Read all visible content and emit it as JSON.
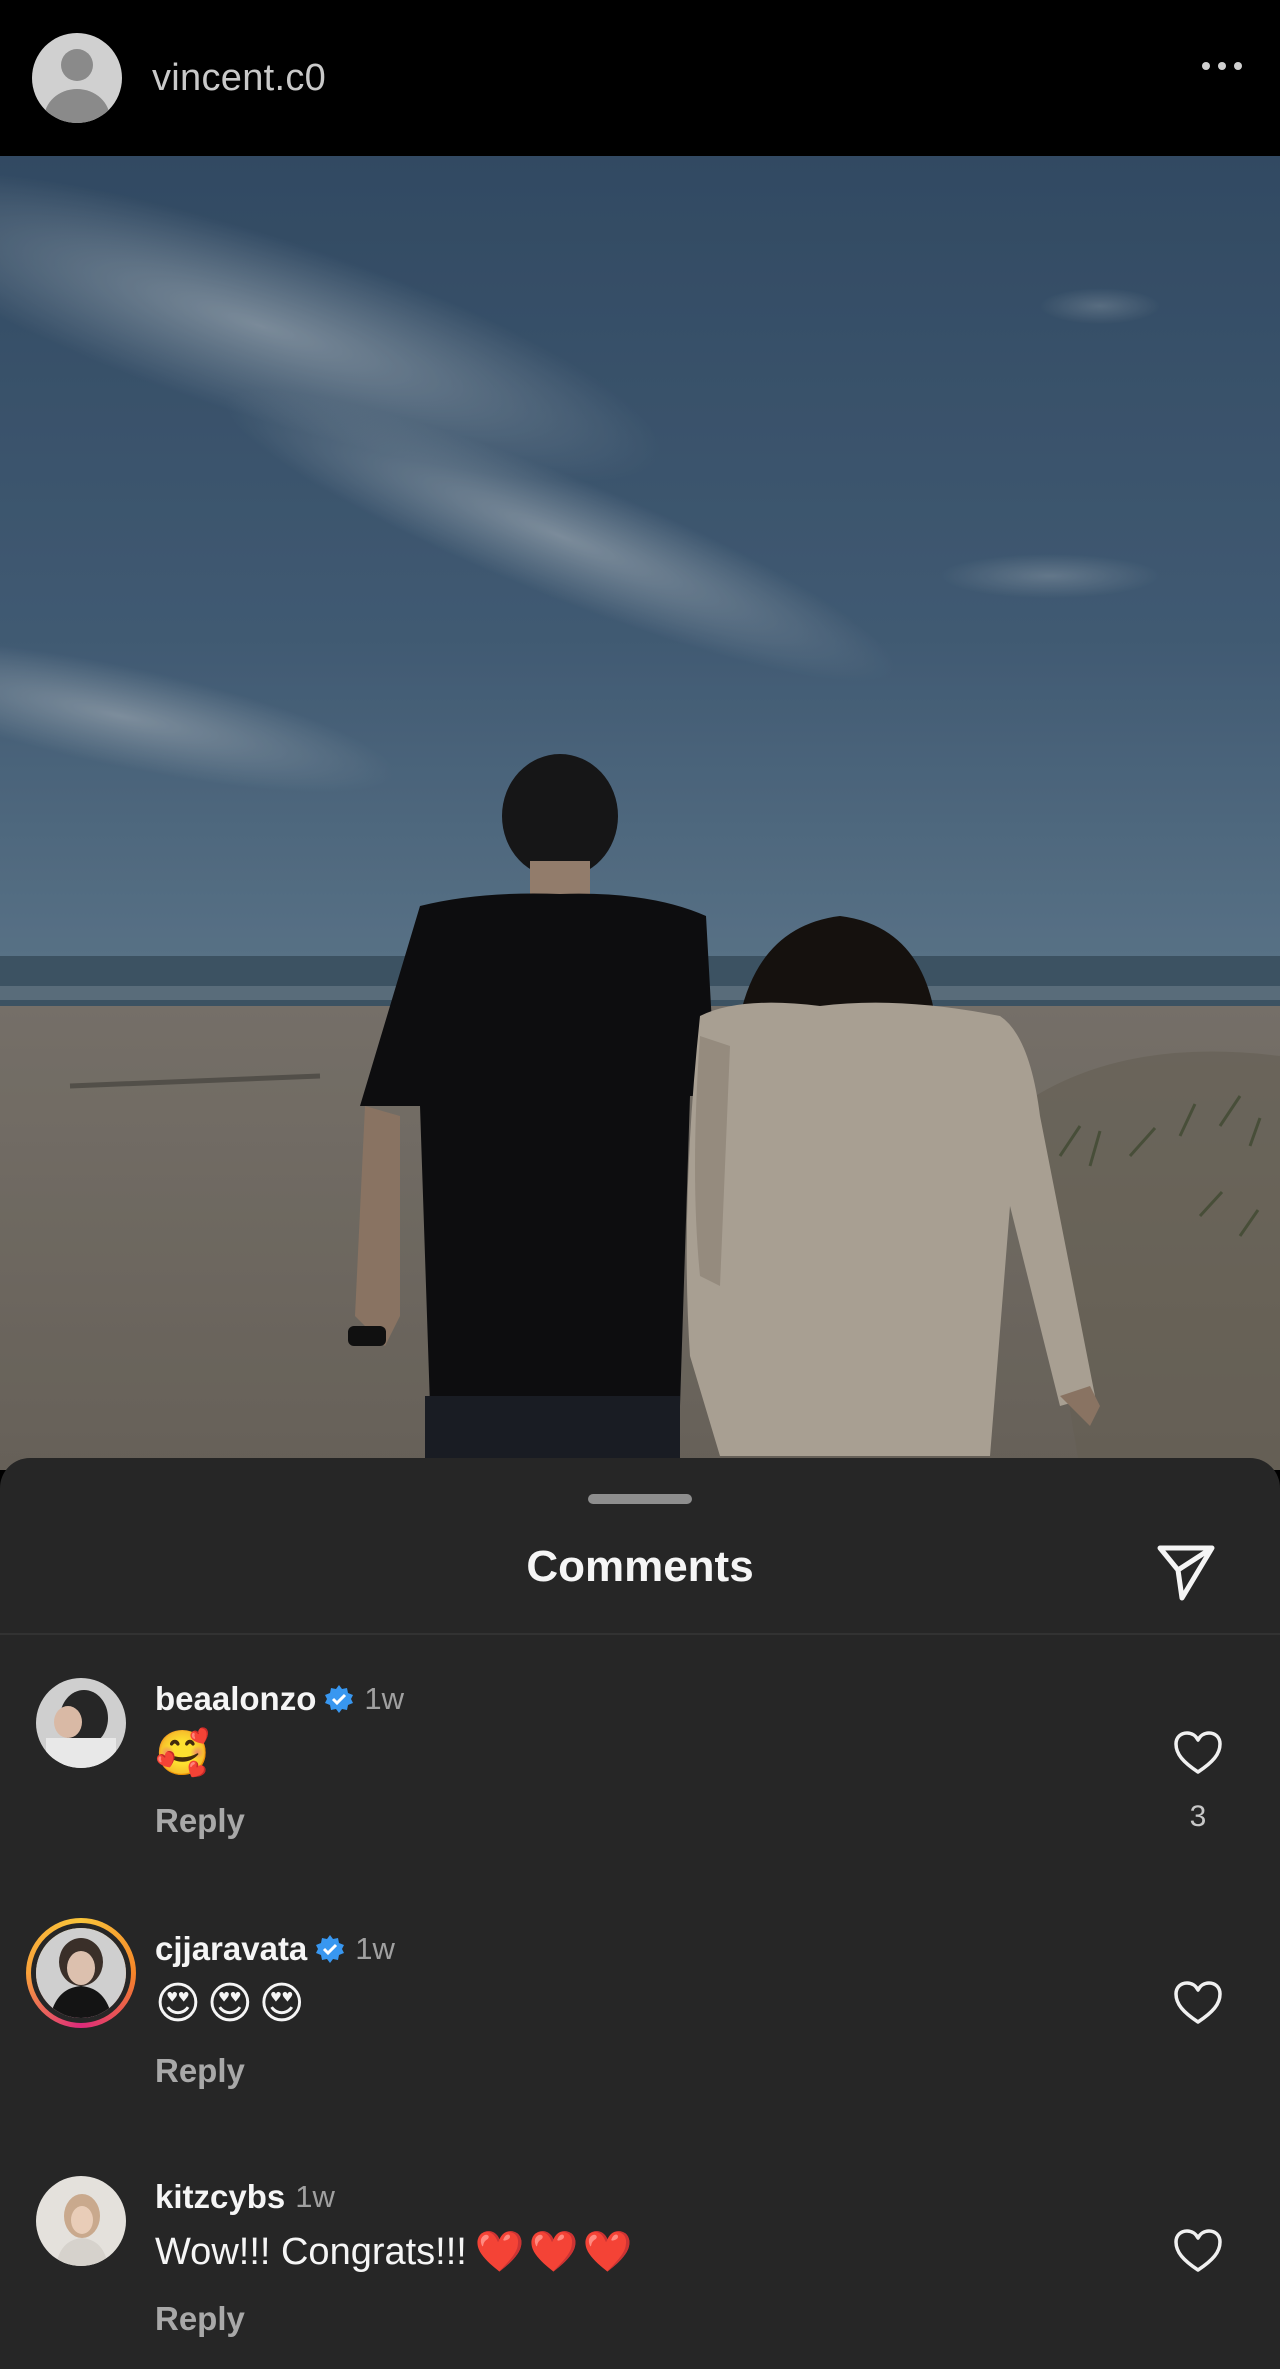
{
  "post": {
    "username": "vincent.c0",
    "more_icon": "ellipsis-icon"
  },
  "comments_sheet": {
    "title": "Comments",
    "share_icon": "paper-plane-icon",
    "comments": [
      {
        "username": "beaalonzo",
        "verified": true,
        "time": "1w",
        "text": "🥰",
        "reply_label": "Reply",
        "like_count": "3"
      },
      {
        "username": "cjjaravata",
        "verified": true,
        "time": "1w",
        "text": "😍😍😍",
        "reply_label": "Reply",
        "like_count": ""
      },
      {
        "username": "kitzcybs",
        "verified": false,
        "time": "1w",
        "text": "Wow!!! Congrats!!!",
        "trailing_text": "❤️❤️❤️",
        "reply_label": "Reply",
        "like_count": ""
      }
    ]
  },
  "colors": {
    "background": "#000000",
    "sheet_background": "#262626",
    "verified_blue": "#3897f0",
    "text_primary": "#f5f5f5",
    "text_secondary": "#a8a8a8",
    "heart_red": "#e0222d"
  }
}
